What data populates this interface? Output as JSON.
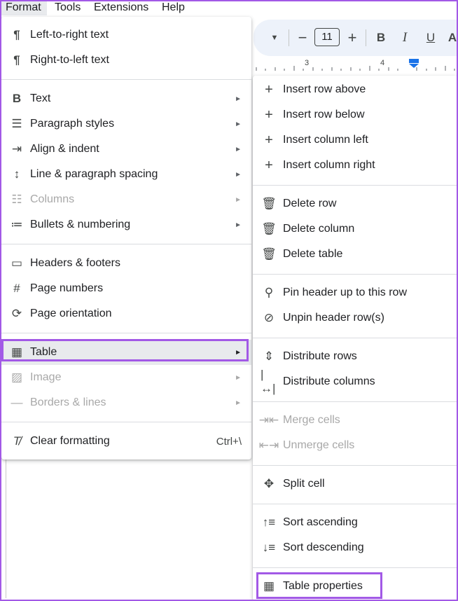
{
  "menubar": {
    "items": [
      "Format",
      "Tools",
      "Extensions",
      "Help"
    ]
  },
  "toolbar": {
    "font_size": "11",
    "minus": "−",
    "plus": "+",
    "bold": "B",
    "italic": "I",
    "underline": "U"
  },
  "ruler": {
    "marks": [
      "3",
      "4"
    ]
  },
  "format_menu": {
    "ltr": "Left-to-right text",
    "rtl": "Right-to-left text",
    "text": "Text",
    "paragraph_styles": "Paragraph styles",
    "align_indent": "Align & indent",
    "spacing": "Line & paragraph spacing",
    "columns": "Columns",
    "bullets": "Bullets & numbering",
    "headers": "Headers & footers",
    "page_numbers": "Page numbers",
    "orientation": "Page orientation",
    "table": "Table",
    "image": "Image",
    "borders": "Borders & lines",
    "clear": "Clear formatting",
    "clear_shortcut": "Ctrl+\\"
  },
  "table_menu": {
    "insert_row_above": "Insert row above",
    "insert_row_below": "Insert row below",
    "insert_col_left": "Insert column left",
    "insert_col_right": "Insert column right",
    "delete_row": "Delete row",
    "delete_column": "Delete column",
    "delete_table": "Delete table",
    "pin_header": "Pin header up to this row",
    "unpin_header": "Unpin header row(s)",
    "distribute_rows": "Distribute rows",
    "distribute_columns": "Distribute columns",
    "merge_cells": "Merge cells",
    "unmerge_cells": "Unmerge cells",
    "split_cell": "Split cell",
    "sort_asc": "Sort ascending",
    "sort_desc": "Sort descending",
    "table_properties": "Table properties"
  },
  "colors": {
    "highlight": "#a259e6",
    "disabled": "#a8a8a8"
  }
}
